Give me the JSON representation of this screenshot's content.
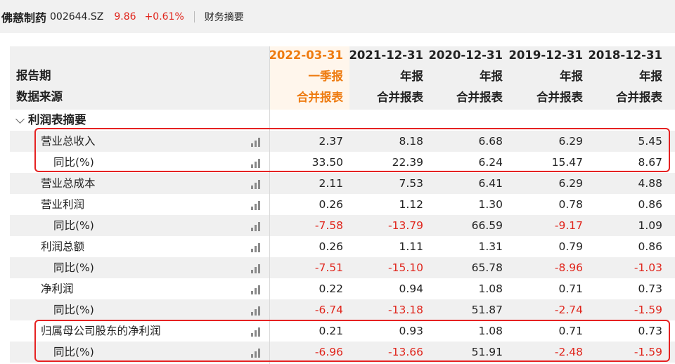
{
  "topbar": {
    "stock_name": "佛慈制药",
    "stock_code": "002644.SZ",
    "price": "9.86",
    "change": "+0.61%",
    "tab_label": "财务摘要"
  },
  "header": {
    "period_label": "报告期",
    "source_label": "数据来源",
    "columns": [
      {
        "date": "2022-03-31",
        "type": "一季报",
        "source": "合并报表"
      },
      {
        "date": "2021-12-31",
        "type": "年报",
        "source": "合并报表"
      },
      {
        "date": "2020-12-31",
        "type": "年报",
        "source": "合并报表"
      },
      {
        "date": "2019-12-31",
        "type": "年报",
        "source": "合并报表"
      },
      {
        "date": "2018-12-31",
        "type": "年报",
        "source": "合并报表"
      }
    ]
  },
  "section": {
    "title": "利润表摘要"
  },
  "rows": [
    {
      "label": "营业总收入",
      "values": [
        "2.37",
        "8.18",
        "6.68",
        "6.29",
        "5.45"
      ]
    },
    {
      "label": "同比(%)",
      "values": [
        "33.50",
        "22.39",
        "6.24",
        "15.47",
        "8.67"
      ]
    },
    {
      "label": "营业总成本",
      "values": [
        "2.11",
        "7.53",
        "6.41",
        "6.29",
        "4.88"
      ]
    },
    {
      "label": "营业利润",
      "values": [
        "0.26",
        "1.12",
        "1.30",
        "0.78",
        "0.86"
      ]
    },
    {
      "label": "同比(%)",
      "values": [
        "-7.58",
        "-13.79",
        "66.59",
        "-9.17",
        "1.09"
      ]
    },
    {
      "label": "利润总额",
      "values": [
        "0.26",
        "1.11",
        "1.31",
        "0.79",
        "0.86"
      ]
    },
    {
      "label": "同比(%)",
      "values": [
        "-7.51",
        "-15.10",
        "65.78",
        "-8.96",
        "-1.03"
      ]
    },
    {
      "label": "净利润",
      "values": [
        "0.22",
        "0.94",
        "1.08",
        "0.71",
        "0.73"
      ]
    },
    {
      "label": "同比(%)",
      "values": [
        "-6.74",
        "-13.18",
        "51.87",
        "-2.74",
        "-1.59"
      ]
    },
    {
      "label": "归属母公司股东的净利润",
      "values": [
        "0.21",
        "0.93",
        "1.08",
        "0.71",
        "0.73"
      ]
    },
    {
      "label": "同比(%)",
      "values": [
        "-6.96",
        "-13.66",
        "51.91",
        "-2.48",
        "-1.59"
      ]
    }
  ],
  "colors": {
    "negative": "#e0251c",
    "highlight_header": "#ee7b10",
    "annotation_box": "#e52222"
  }
}
